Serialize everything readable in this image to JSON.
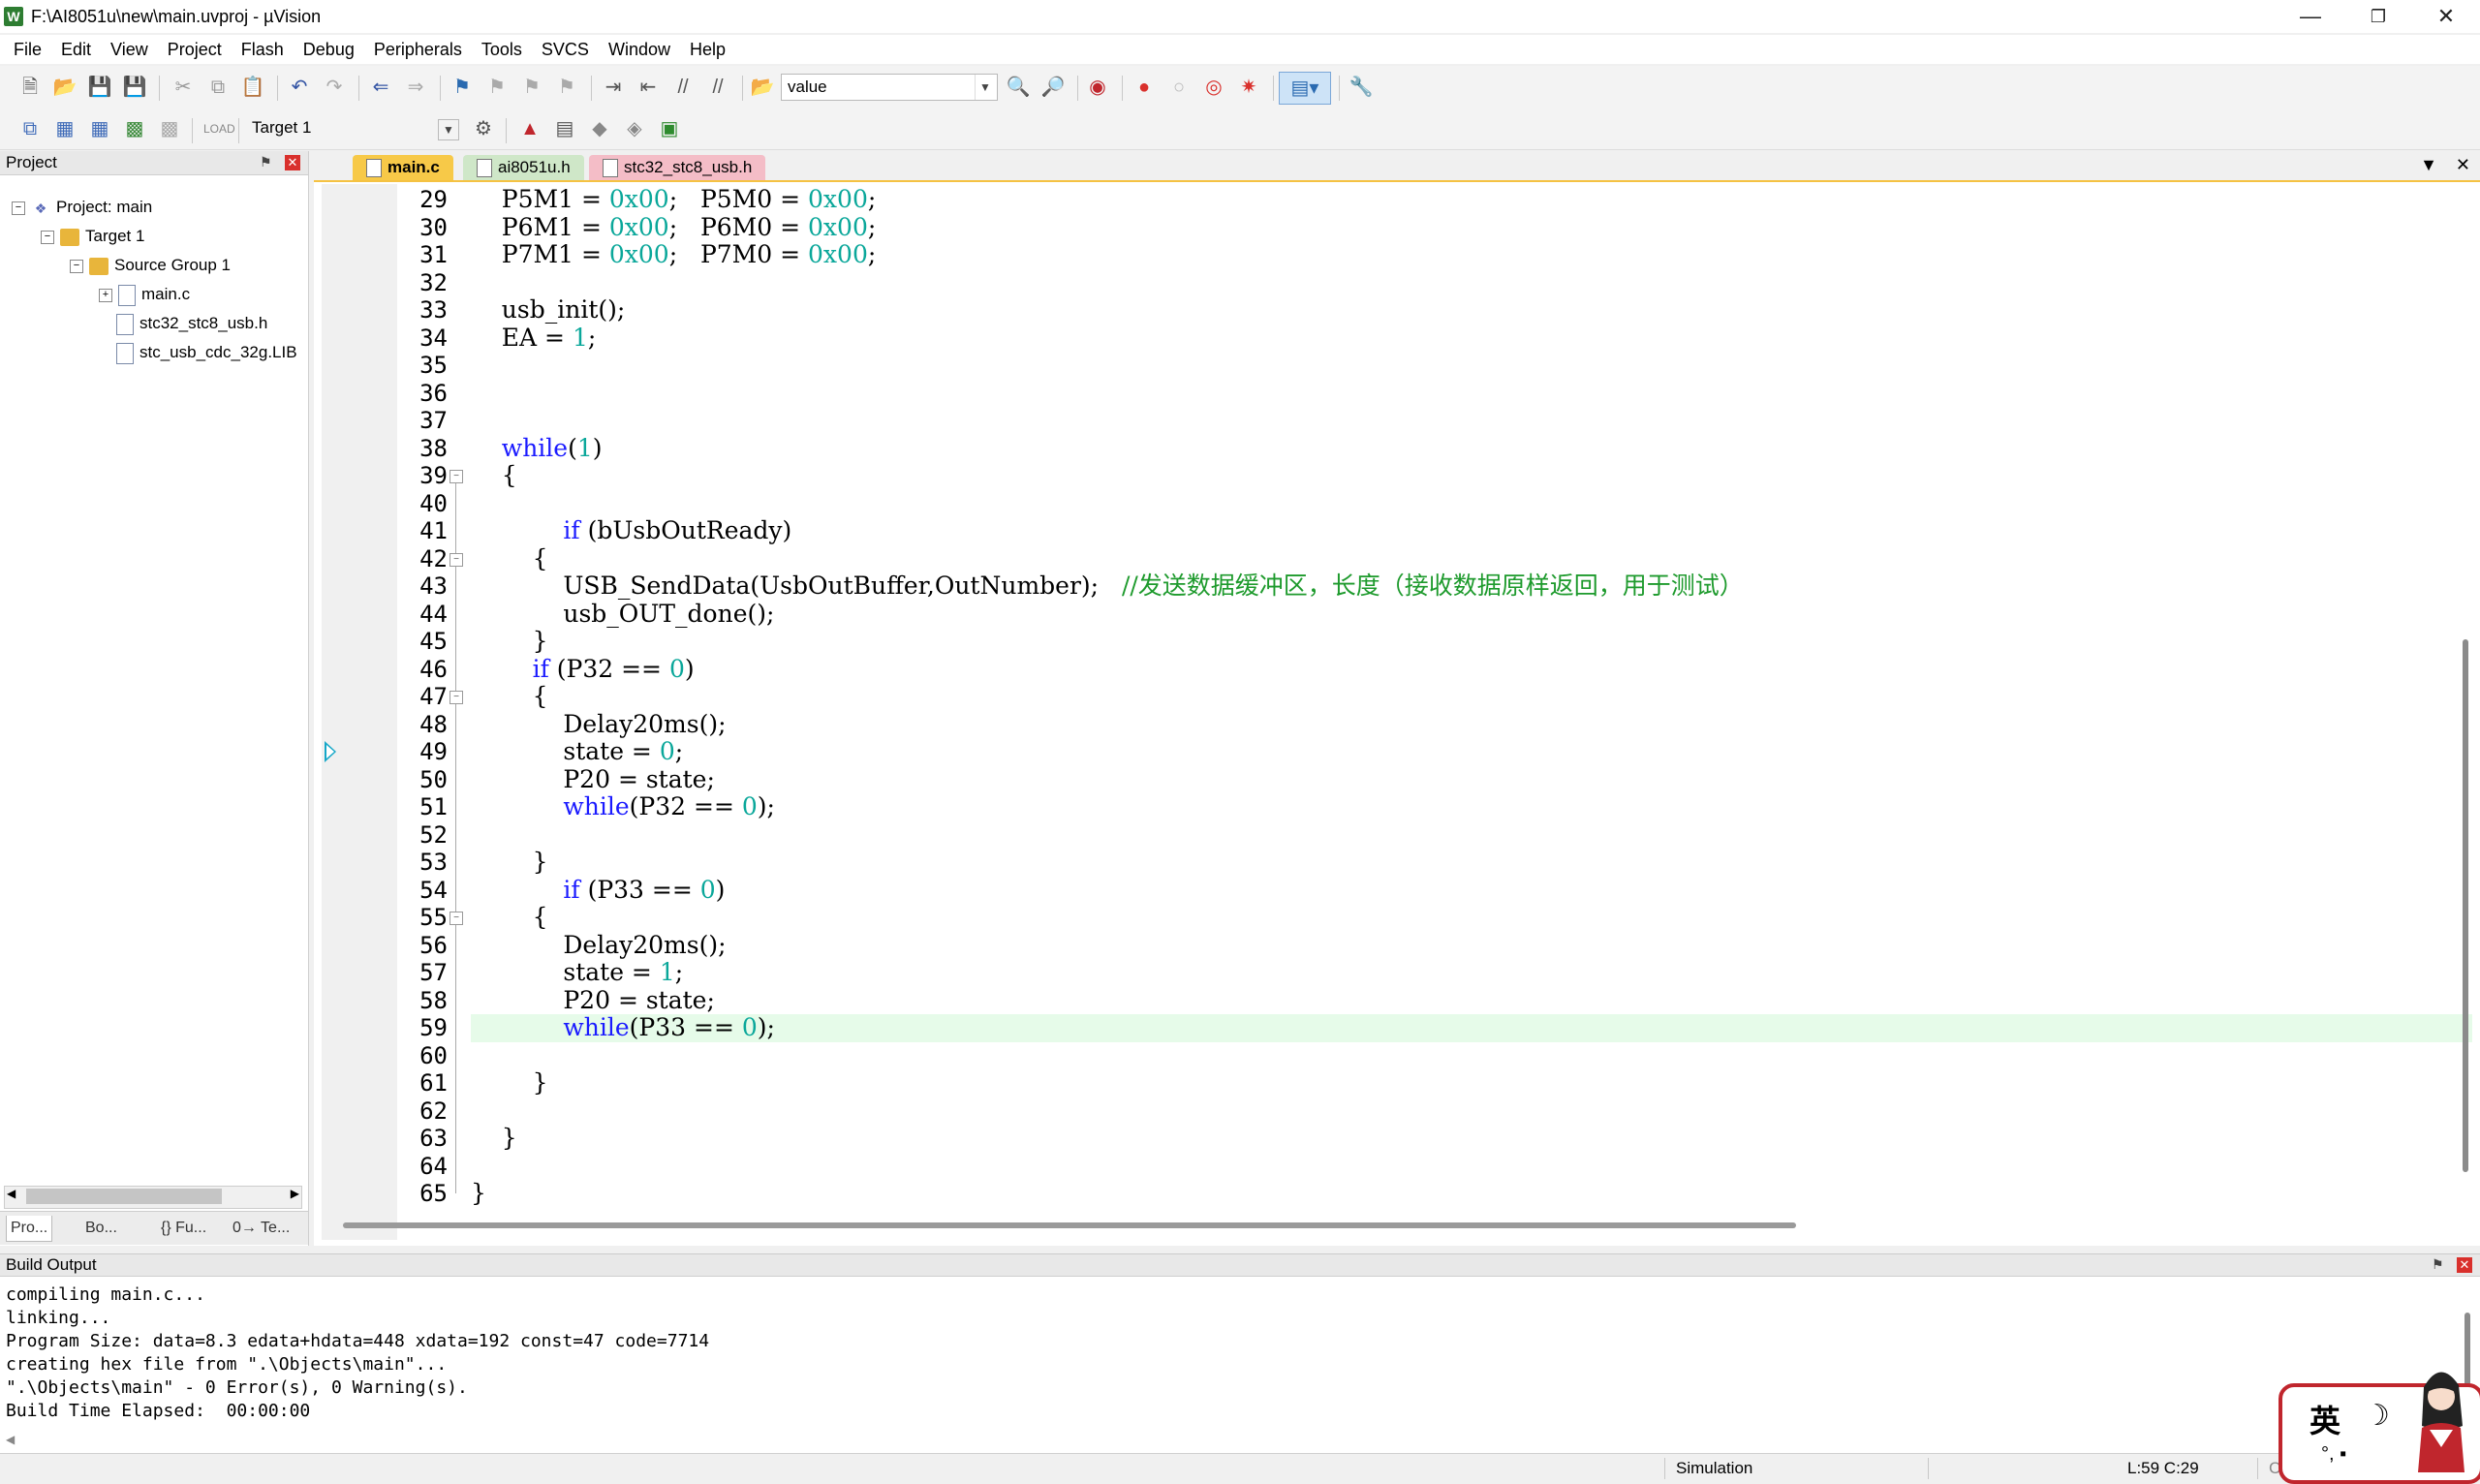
{
  "window": {
    "title": "F:\\AI8051u\\new\\main.uvproj - µVision",
    "app_icon": "W"
  },
  "menu": [
    "File",
    "Edit",
    "View",
    "Project",
    "Flash",
    "Debug",
    "Peripherals",
    "Tools",
    "SVCS",
    "Window",
    "Help"
  ],
  "toolbar": {
    "find_value": "value",
    "target": "Target 1",
    "icons": [
      "new-file-icon",
      "open-file-icon",
      "save-icon",
      "save-all-icon",
      "cut-icon",
      "copy-icon",
      "paste-icon",
      "undo-icon",
      "redo-icon",
      "nav-back-icon",
      "nav-forward-icon",
      "bookmark-icon",
      "prev-bookmark-icon",
      "next-bookmark-icon",
      "clear-bookmarks-icon",
      "indent-icon",
      "unindent-icon",
      "comment-icon",
      "uncomment-icon",
      "find-in-files-icon",
      "find-icon",
      "incremental-find-icon",
      "debug-session-icon",
      "breakpoint-icon",
      "disable-breakpoint-icon",
      "disable-all-breakpoints-icon",
      "kill-all-breakpoints-icon",
      "window-layout-icon",
      "configure-icon"
    ]
  },
  "project_panel": {
    "title": "Project",
    "tree": [
      {
        "label": "Project: main",
        "level": 0,
        "icon": "project-icon",
        "expander": "−"
      },
      {
        "label": "Target 1",
        "level": 1,
        "icon": "target-folder-icon",
        "expander": "−"
      },
      {
        "label": "Source Group 1",
        "level": 2,
        "icon": "folder-icon",
        "expander": "−"
      },
      {
        "label": "main.c",
        "level": 3,
        "icon": "file-icon",
        "expander": "+"
      },
      {
        "label": "stc32_stc8_usb.h",
        "level": 3,
        "icon": "file-icon",
        "expander": ""
      },
      {
        "label": "stc_usb_cdc_32g.LIB",
        "level": 3,
        "icon": "file-icon",
        "expander": ""
      }
    ],
    "tabs": [
      "Pro...",
      "Bo...",
      "{} Fu...",
      "0→ Te..."
    ]
  },
  "editor": {
    "tabs": [
      "main.c",
      "ai8051u.h",
      "stc32_stc8_usb.h"
    ],
    "active_tab": "main.c",
    "lines": [
      {
        "n": "29",
        "html": "    P5M1 = <span class=\"num\">0x00</span>;   P5M0 = <span class=\"num\">0x00</span>;"
      },
      {
        "n": "30",
        "html": "    P6M1 = <span class=\"num\">0x00</span>;   P6M0 = <span class=\"num\">0x00</span>;"
      },
      {
        "n": "31",
        "html": "    P7M1 = <span class=\"num\">0x00</span>;   P7M0 = <span class=\"num\">0x00</span>;"
      },
      {
        "n": "32",
        "html": ""
      },
      {
        "n": "33",
        "html": "    usb_init();"
      },
      {
        "n": "34",
        "html": "    EA = <span class=\"num\">1</span>;"
      },
      {
        "n": "35",
        "html": ""
      },
      {
        "n": "36",
        "html": ""
      },
      {
        "n": "37",
        "html": ""
      },
      {
        "n": "38",
        "html": "    <span class=\"kw\">while</span>(<span class=\"num\">1</span>)"
      },
      {
        "n": "39",
        "html": "    {"
      },
      {
        "n": "40",
        "html": ""
      },
      {
        "n": "41",
        "html": "            <span class=\"kw\">if</span> (bUsbOutReady)"
      },
      {
        "n": "42",
        "html": "        {"
      },
      {
        "n": "43",
        "html": "            USB_SendData(UsbOutBuffer,OutNumber);   <span class=\"cmt\">//发送数据缓冲区，长度（接收数据原样返回，用于测试）</span>"
      },
      {
        "n": "44",
        "html": "            usb_OUT_done();"
      },
      {
        "n": "45",
        "html": "        }"
      },
      {
        "n": "46",
        "html": "        <span class=\"kw\">if</span> (P32 == <span class=\"num\">0</span>)"
      },
      {
        "n": "47",
        "html": "        {"
      },
      {
        "n": "48",
        "html": "            Delay20ms();"
      },
      {
        "n": "49",
        "html": "            state = <span class=\"num\">0</span>;"
      },
      {
        "n": "50",
        "html": "            P20 = state;"
      },
      {
        "n": "51",
        "html": "            <span class=\"kw\">while</span>(P32 == <span class=\"num\">0</span>);"
      },
      {
        "n": "52",
        "html": ""
      },
      {
        "n": "53",
        "html": "        }"
      },
      {
        "n": "54",
        "html": "            <span class=\"kw\">if</span> (P33 == <span class=\"num\">0</span>)"
      },
      {
        "n": "55",
        "html": "        {"
      },
      {
        "n": "56",
        "html": "            Delay20ms();"
      },
      {
        "n": "57",
        "html": "            state = <span class=\"num\">1</span>;"
      },
      {
        "n": "58",
        "html": "            P20 = state;"
      },
      {
        "n": "59",
        "html": "            <span class=\"kw\">while</span>(P33 == <span class=\"num\">0</span>);"
      },
      {
        "n": "60",
        "html": ""
      },
      {
        "n": "61",
        "html": "        }"
      },
      {
        "n": "62",
        "html": ""
      },
      {
        "n": "63",
        "html": "    }"
      },
      {
        "n": "64",
        "html": ""
      },
      {
        "n": "65",
        "html": "}"
      }
    ],
    "current_line": "59",
    "exec_marker_line": "49",
    "fold_markers": [
      "39",
      "42",
      "47",
      "55"
    ]
  },
  "build_output": {
    "title": "Build Output",
    "lines": [
      "compiling main.c...",
      "linking...",
      "Program Size: data=8.3 edata+hdata=448 xdata=192 const=47 code=7714",
      "creating hex file from \".\\Objects\\main\"...",
      "\".\\Objects\\main\" - 0 Error(s), 0 Warning(s).",
      "Build Time Elapsed:  00:00:00"
    ]
  },
  "status_bar": {
    "mode": "Simulation",
    "position": "L:59 C:29",
    "extra": "Ca"
  },
  "ime": {
    "lang": "英",
    "moon": "☽",
    "extra": "°,  ▪"
  },
  "colors": {
    "keyword": "#1a1aff",
    "number": "#0aa79a",
    "comment": "#1d9a2c",
    "current_line": "#e6fbe9",
    "tab_active": "#f7c948"
  }
}
